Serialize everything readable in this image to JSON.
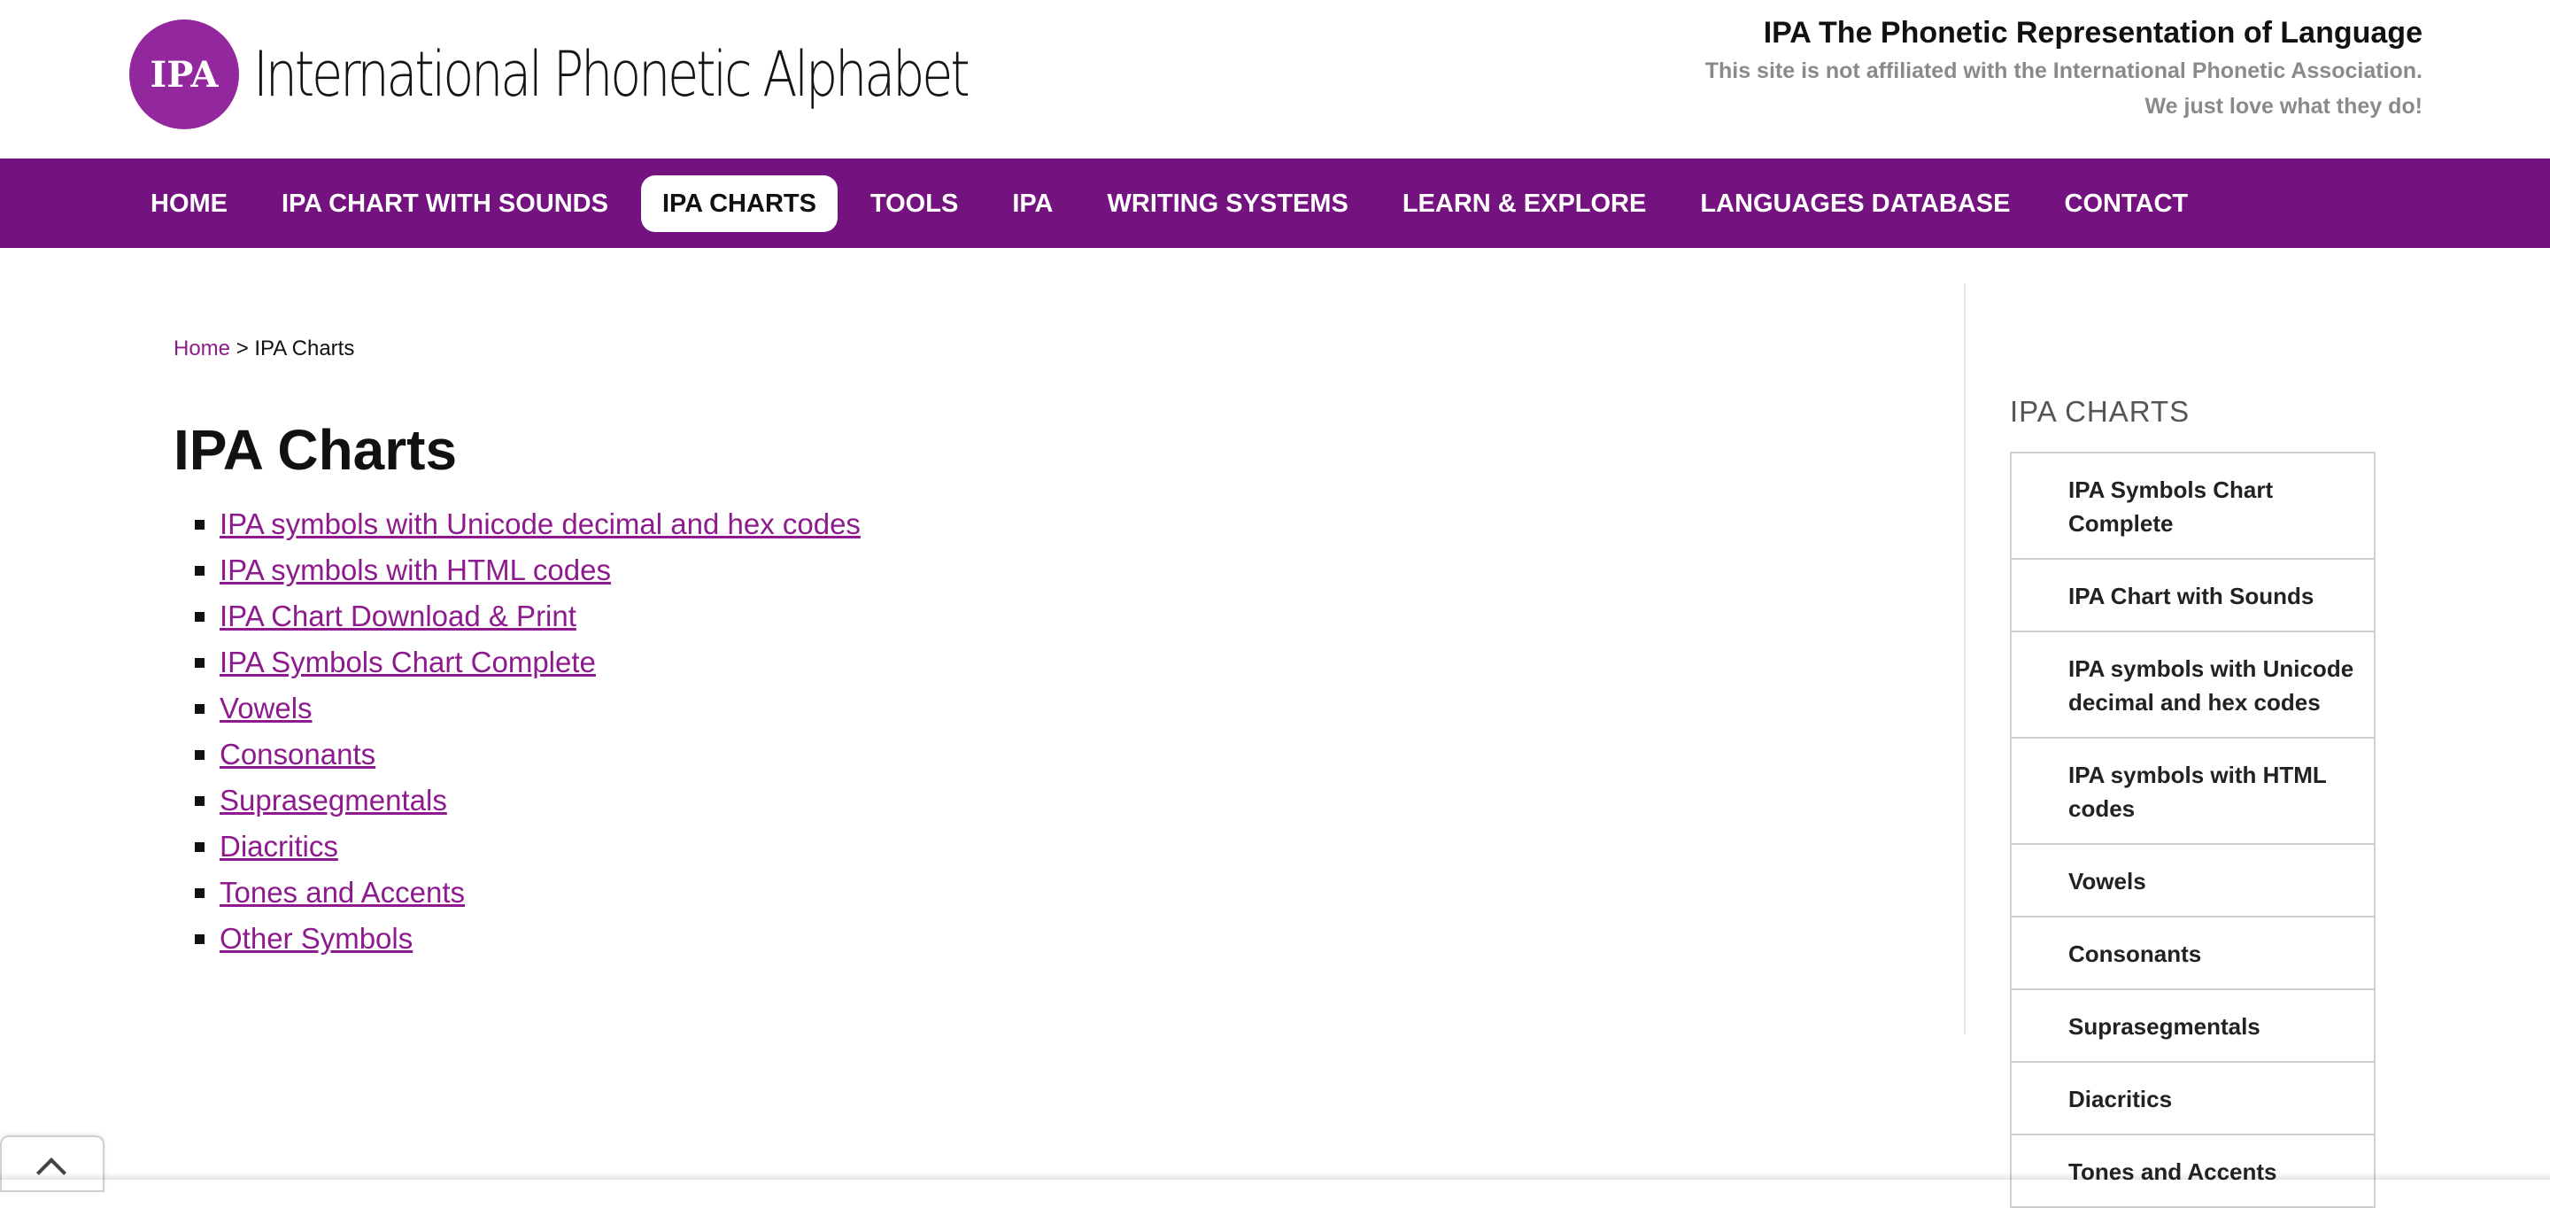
{
  "header": {
    "logo_badge": "IPA",
    "logo_text": "International Phonetic Alphabet",
    "tagline_title": "IPA The Phonetic Representation of Language",
    "tagline_line1": "This site is not affiliated with the International Phonetic Association.",
    "tagline_line2": "We just love what they do!"
  },
  "nav": {
    "items": [
      {
        "label": "HOME"
      },
      {
        "label": "IPA CHART WITH SOUNDS"
      },
      {
        "label": "IPA CHARTS",
        "active": true
      },
      {
        "label": "TOOLS"
      },
      {
        "label": "IPA"
      },
      {
        "label": "WRITING SYSTEMS"
      },
      {
        "label": "LEARN & EXPLORE"
      },
      {
        "label": "LANGUAGES DATABASE"
      },
      {
        "label": "CONTACT"
      }
    ]
  },
  "breadcrumb": {
    "home": "Home",
    "separator": ">",
    "current": "IPA Charts"
  },
  "main": {
    "title": "IPA Charts",
    "links": [
      "IPA symbols with Unicode decimal and hex codes",
      "IPA symbols with HTML codes",
      "IPA Chart Download & Print",
      "IPA Symbols Chart Complete",
      "Vowels",
      "Consonants",
      "Suprasegmentals",
      "Diacritics",
      "Tones and Accents",
      "Other Symbols"
    ]
  },
  "sidebar": {
    "title": "IPA CHARTS",
    "items": [
      "IPA Symbols Chart Complete",
      "IPA Chart with Sounds",
      "IPA symbols with Unicode decimal and hex codes",
      "IPA symbols with HTML codes",
      "Vowels",
      "Consonants",
      "Suprasegmentals",
      "Diacritics",
      "Tones and Accents"
    ]
  },
  "colors": {
    "brand_purple": "#74137f",
    "link_purple": "#8d1b8d",
    "logo_circle": "#93279e"
  },
  "icons": {
    "scroll_top": "chevron-up-icon"
  }
}
